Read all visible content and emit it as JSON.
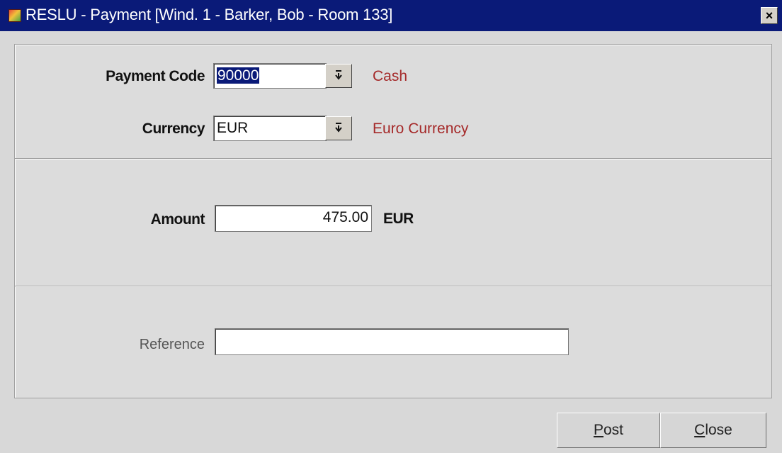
{
  "window": {
    "title": "RESLU - Payment [Wind. 1 - Barker, Bob - Room 133]",
    "close_label": "×",
    "app_icon": "app-icon"
  },
  "payment_code": {
    "label": "Payment Code",
    "value": "90000",
    "description": "Cash",
    "dropdown_icon": "arrow-down-icon"
  },
  "currency": {
    "label": "Currency",
    "value": "EUR",
    "description": "Euro Currency",
    "dropdown_icon": "arrow-down-icon"
  },
  "amount": {
    "label": "Amount",
    "value": "475.00",
    "unit": "EUR"
  },
  "reference": {
    "label": "Reference",
    "value": ""
  },
  "buttons": {
    "post": {
      "mnemonic": "P",
      "rest": "ost"
    },
    "close": {
      "mnemonic": "C",
      "rest": "lose"
    }
  },
  "colors": {
    "titlebar": "#0a1a78",
    "description_text": "#a52a2a",
    "background": "#d8d8d8"
  }
}
